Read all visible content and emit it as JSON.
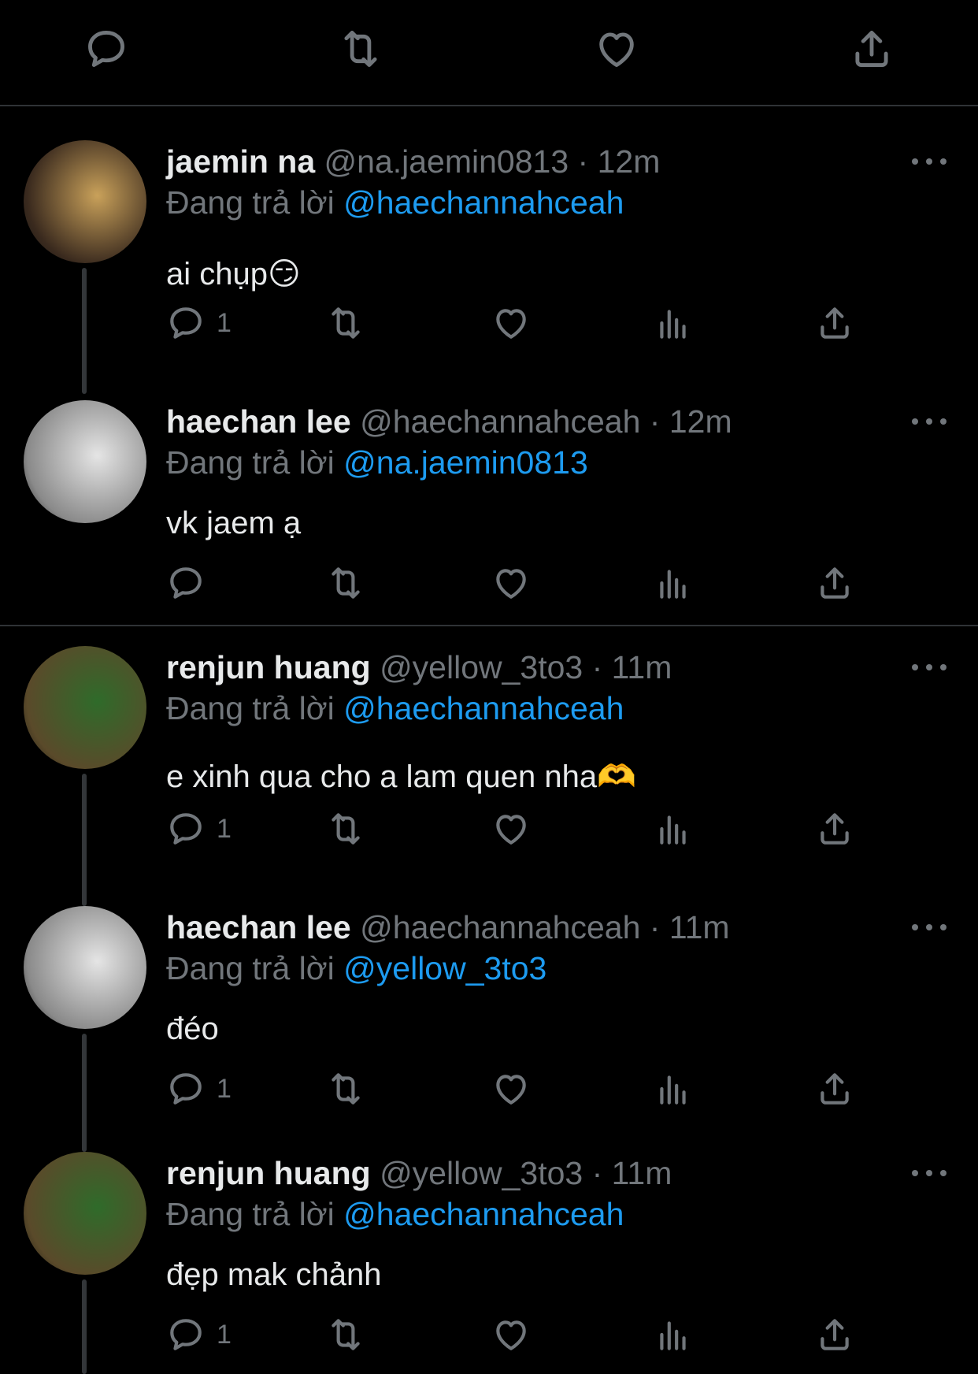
{
  "top_actions": [
    {
      "name": "reply-icon"
    },
    {
      "name": "retweet-icon"
    },
    {
      "name": "like-icon"
    },
    {
      "name": "share-icon"
    }
  ],
  "tweets": [
    {
      "display_name": "jaemin na",
      "handle": "@na.jaemin0813",
      "time": "12m",
      "reply_prefix": "Đang trả lời",
      "reply_to": "@haechannahceah",
      "text": "ai chụp😏",
      "reply_count": "1",
      "avatar_colors": [
        "#3a2a1e",
        "#c9a15a"
      ]
    },
    {
      "display_name": "haechan lee",
      "handle": "@haechannahceah",
      "time": "12m",
      "reply_prefix": "Đang trả lời",
      "reply_to": "@na.jaemin0813",
      "text": "vk jaem ạ",
      "reply_count": "",
      "avatar_colors": [
        "#8a8a8a",
        "#e5e5e5"
      ]
    },
    {
      "display_name": "renjun huang",
      "handle": "@yellow_3to3",
      "time": "11m",
      "reply_prefix": "Đang trả lời",
      "reply_to": "@haechannahceah",
      "text": "e xinh qua cho a lam quen nha🫶",
      "reply_count": "1",
      "avatar_colors": [
        "#5a4a2a",
        "#2f6b2a"
      ]
    },
    {
      "display_name": "haechan lee",
      "handle": "@haechannahceah",
      "time": "11m",
      "reply_prefix": "Đang trả lời",
      "reply_to": "@yellow_3to3",
      "text": "đéo",
      "reply_count": "1",
      "avatar_colors": [
        "#8a8a8a",
        "#e5e5e5"
      ]
    },
    {
      "display_name": "renjun huang",
      "handle": "@yellow_3to3",
      "time": "11m",
      "reply_prefix": "Đang trả lời",
      "reply_to": "@haechannahceah",
      "text": "đẹp mak chảnh",
      "reply_count": "1",
      "avatar_colors": [
        "#5a4a2a",
        "#2f6b2a"
      ]
    }
  ],
  "colors": {
    "background": "#000000",
    "text": "#e7e9ea",
    "muted": "#71767b",
    "link": "#1d9bf0",
    "divider": "#2f3336"
  }
}
